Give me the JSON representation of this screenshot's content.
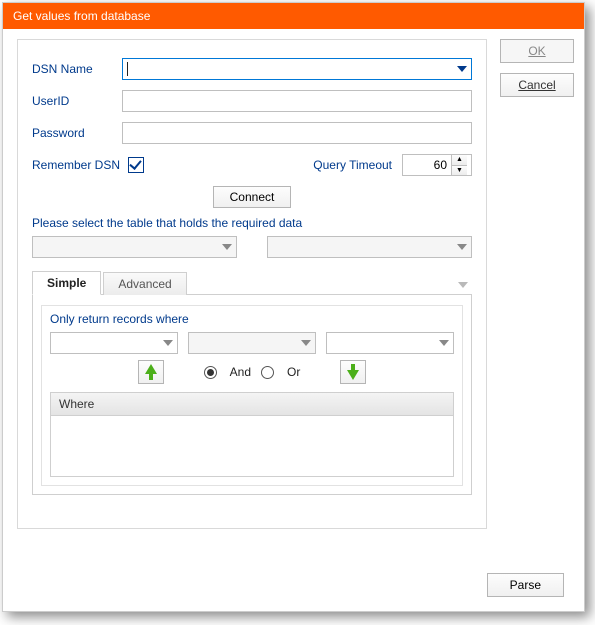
{
  "title": "Get values from database",
  "buttons": {
    "ok": "OK",
    "cancel": "Cancel",
    "connect": "Connect",
    "parse": "Parse"
  },
  "form": {
    "dsn_label": "DSN Name",
    "dsn_value": "",
    "userid_label": "UserID",
    "userid_value": "",
    "password_label": "Password",
    "password_value": "",
    "remember_label": "Remember DSN",
    "remember_checked": true,
    "query_timeout_label": "Query Timeout",
    "query_timeout_value": "60"
  },
  "tables_label": "Please select the table that holds the required data",
  "tabs": {
    "simple": "Simple",
    "advanced": "Advanced"
  },
  "filter": {
    "heading": "Only return records where",
    "and": "And",
    "or": "Or",
    "grid_header": "Where"
  }
}
